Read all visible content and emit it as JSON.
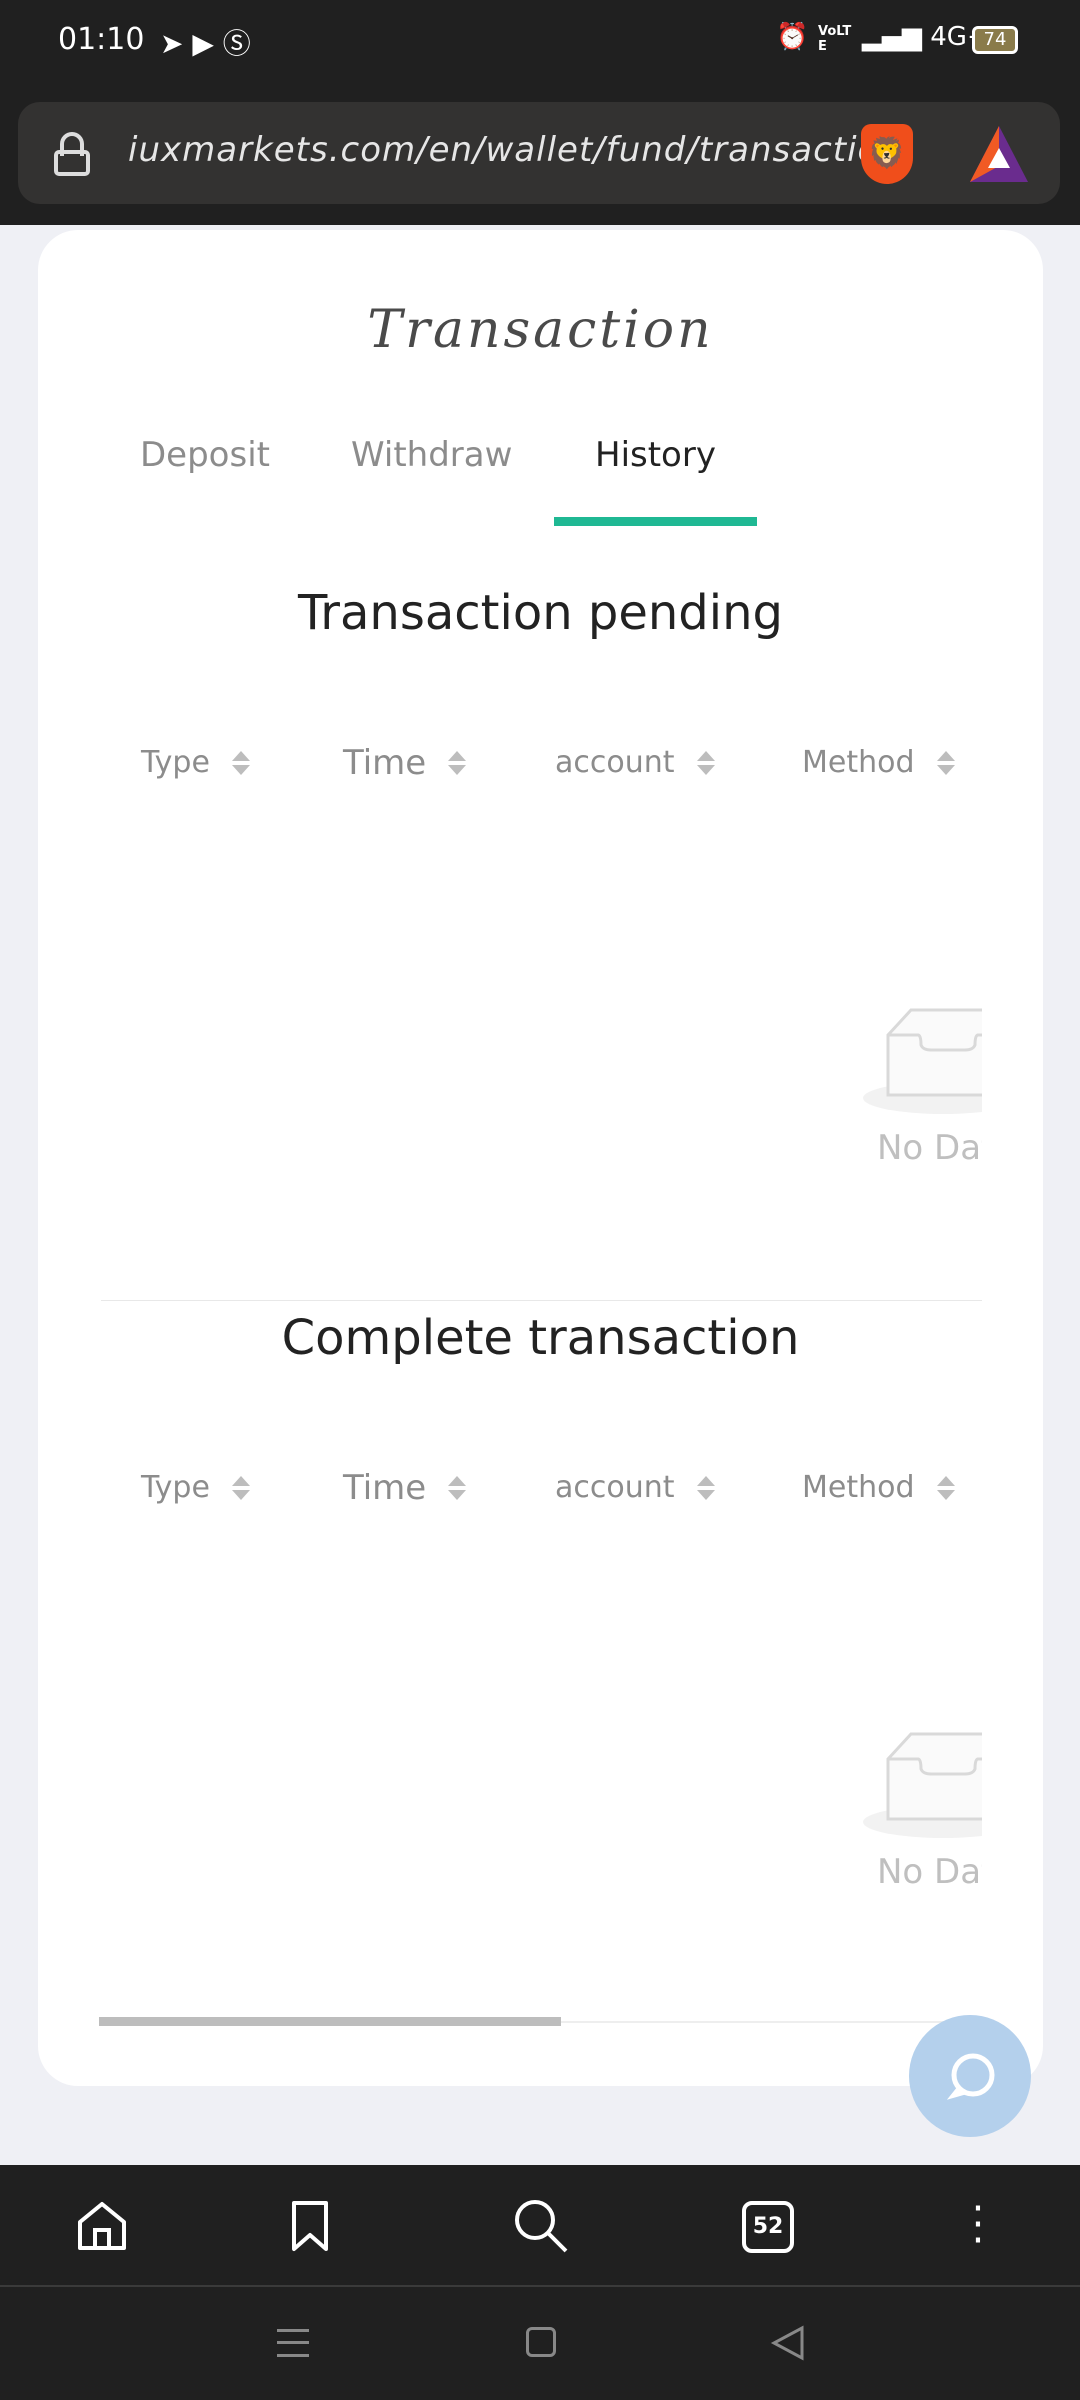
{
  "status_bar": {
    "time": "01:10",
    "battery": "74",
    "network": "4G+",
    "volte": "VoLTE"
  },
  "browser": {
    "url": "iuxmarkets.com/en/wallet/fund/transaction",
    "tab_count": "52"
  },
  "page": {
    "title": "Transaction",
    "tabs": [
      {
        "label": "Deposit"
      },
      {
        "label": "Withdraw"
      },
      {
        "label": "History",
        "active": true
      }
    ],
    "pending": {
      "title": "Transaction pending",
      "columns": [
        "Type",
        "Time",
        "account",
        "Method"
      ],
      "empty_text": "No Data"
    },
    "complete": {
      "title": "Complete transaction",
      "columns": [
        "Type",
        "Time",
        "account",
        "Method"
      ],
      "empty_text": "No Data"
    }
  },
  "colors": {
    "accent": "#1fb893",
    "chat_button": "#b4d0ec"
  }
}
